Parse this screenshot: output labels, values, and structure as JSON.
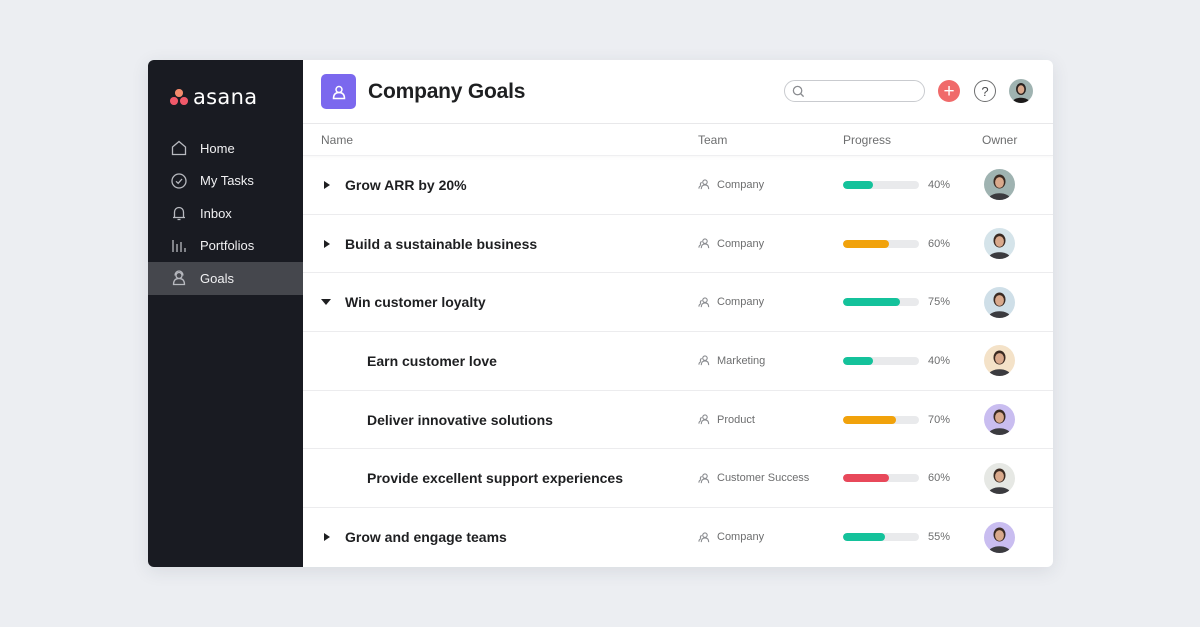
{
  "app": {
    "logo_text": "asana"
  },
  "sidebar": {
    "items": [
      {
        "label": "Home",
        "icon": "home-icon",
        "active": false
      },
      {
        "label": "My Tasks",
        "icon": "check-circle-icon",
        "active": false
      },
      {
        "label": "Inbox",
        "icon": "bell-icon",
        "active": false
      },
      {
        "label": "Portfolios",
        "icon": "bar-chart-icon",
        "active": false
      },
      {
        "label": "Goals",
        "icon": "goal-person-icon",
        "active": true
      }
    ]
  },
  "header": {
    "title": "Company Goals",
    "search_placeholder": "",
    "add_label": "+",
    "help_label": "?"
  },
  "table": {
    "columns": {
      "name": "Name",
      "team": "Team",
      "progress": "Progress",
      "owner": "Owner"
    },
    "rows": [
      {
        "name": "Grow ARR by 20%",
        "expander": "collapsed",
        "level": 0,
        "team": "Company",
        "progress": 40,
        "progress_label": "40%",
        "status_color": "#14c29b",
        "owner_bg": "#9fb3b1"
      },
      {
        "name": "Build a sustainable business",
        "expander": "collapsed",
        "level": 0,
        "team": "Company",
        "progress": 60,
        "progress_label": "60%",
        "status_color": "#f1a20b",
        "owner_bg": "#d5e4ea"
      },
      {
        "name": "Win customer loyalty",
        "expander": "expanded",
        "level": 0,
        "team": "Company",
        "progress": 75,
        "progress_label": "75%",
        "status_color": "#14c29b",
        "owner_bg": "#cfdfe8"
      },
      {
        "name": "Earn customer love",
        "expander": "none",
        "level": 1,
        "team": "Marketing",
        "progress": 40,
        "progress_label": "40%",
        "status_color": "#14c29b",
        "owner_bg": "#f4e2c8"
      },
      {
        "name": "Deliver innovative solutions",
        "expander": "none",
        "level": 1,
        "team": "Product",
        "progress": 70,
        "progress_label": "70%",
        "status_color": "#f1a20b",
        "owner_bg": "#c9bdf0"
      },
      {
        "name": "Provide excellent support experiences",
        "expander": "none",
        "level": 1,
        "team": "Customer Success",
        "progress": 60,
        "progress_label": "60%",
        "status_color": "#e8485a",
        "owner_bg": "#e6e8e4"
      },
      {
        "name": "Grow and engage teams",
        "expander": "collapsed",
        "level": 0,
        "team": "Company",
        "progress": 55,
        "progress_label": "55%",
        "status_color": "#14c29b",
        "owner_bg": "#c9bdf0"
      }
    ]
  },
  "colors": {
    "accent": "#7b68ee",
    "add_button": "#f06a6a",
    "on_track": "#14c29b",
    "at_risk": "#f1a20b",
    "off_track": "#e8485a"
  }
}
